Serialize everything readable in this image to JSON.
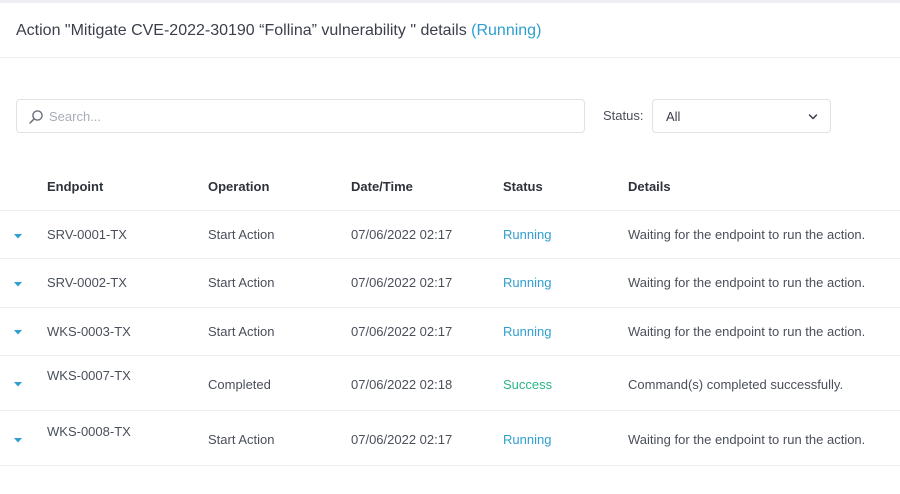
{
  "header": {
    "title": "Action \"Mitigate CVE-2022-30190 “Follina” vulnerability \" details",
    "status": "(Running)"
  },
  "search": {
    "placeholder": "Search...",
    "value": ""
  },
  "filter": {
    "label": "Status:",
    "selected": "All"
  },
  "table": {
    "columns": [
      "Endpoint",
      "Operation",
      "Date/Time",
      "Status",
      "Details"
    ],
    "rows": [
      {
        "endpoint": "SRV-0001-TX",
        "operation": "Start Action",
        "datetime": "07/06/2022 02:17",
        "status": "Running",
        "details": "Waiting for the endpoint to run the action."
      },
      {
        "endpoint": "SRV-0002-TX",
        "operation": "Start Action",
        "datetime": "07/06/2022 02:17",
        "status": "Running",
        "details": "Waiting for the endpoint to run the action."
      },
      {
        "endpoint": "WKS-0003-TX",
        "operation": "Start Action",
        "datetime": "07/06/2022 02:17",
        "status": "Running",
        "details": "Waiting for the endpoint to run the action."
      },
      {
        "endpoint": "WKS-0007-TX",
        "operation": "Completed",
        "datetime": "07/06/2022 02:18",
        "status": "Success",
        "details": "Command(s) completed successfully."
      },
      {
        "endpoint": "WKS-0008-TX",
        "operation": "Start Action",
        "datetime": "07/06/2022 02:17",
        "status": "Running",
        "details": "Waiting for the endpoint to run the action."
      }
    ]
  },
  "colors": {
    "running": "#2f9fd0",
    "success": "#2bb587",
    "expand_arrow": "#2f9fd0"
  },
  "icons": {
    "search": "search-icon",
    "dropdown": "chevron-down-icon",
    "expand": "caret-down-icon"
  }
}
